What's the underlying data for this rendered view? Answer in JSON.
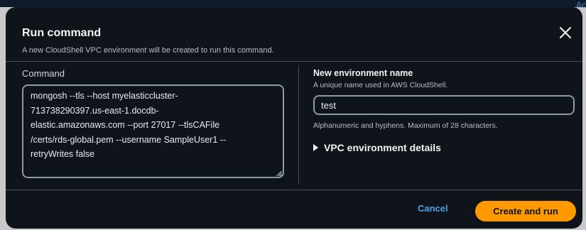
{
  "background": {
    "link_fragment": "Ac"
  },
  "modal": {
    "title": "Run command",
    "subtitle": "A new CloudShell VPC environment will be created to run this command.",
    "close_icon": "close-icon"
  },
  "command": {
    "label": "Command",
    "value": "mongosh --tls --host myelasticcluster-\n713738290397.us-east-1.docdb-\nelastic.amazonaws.com --port 27017 --tlsCAFile\n/certs/rds-global.pem --username SampleUser1 --\nretryWrites false"
  },
  "environment": {
    "label": "New environment name",
    "description": "A unique name used in AWS CloudShell.",
    "value": "test",
    "constraint": "Alphanumeric and hyphens. Maximum of 28 characters."
  },
  "vpc_details": {
    "label": "VPC environment details",
    "expanded": false
  },
  "footer": {
    "cancel_label": "Cancel",
    "primary_label": "Create and run"
  },
  "colors": {
    "modal_bg": "#0f141a",
    "primary": "#ff9900",
    "link": "#539fe5",
    "border": "#8d99a8"
  }
}
